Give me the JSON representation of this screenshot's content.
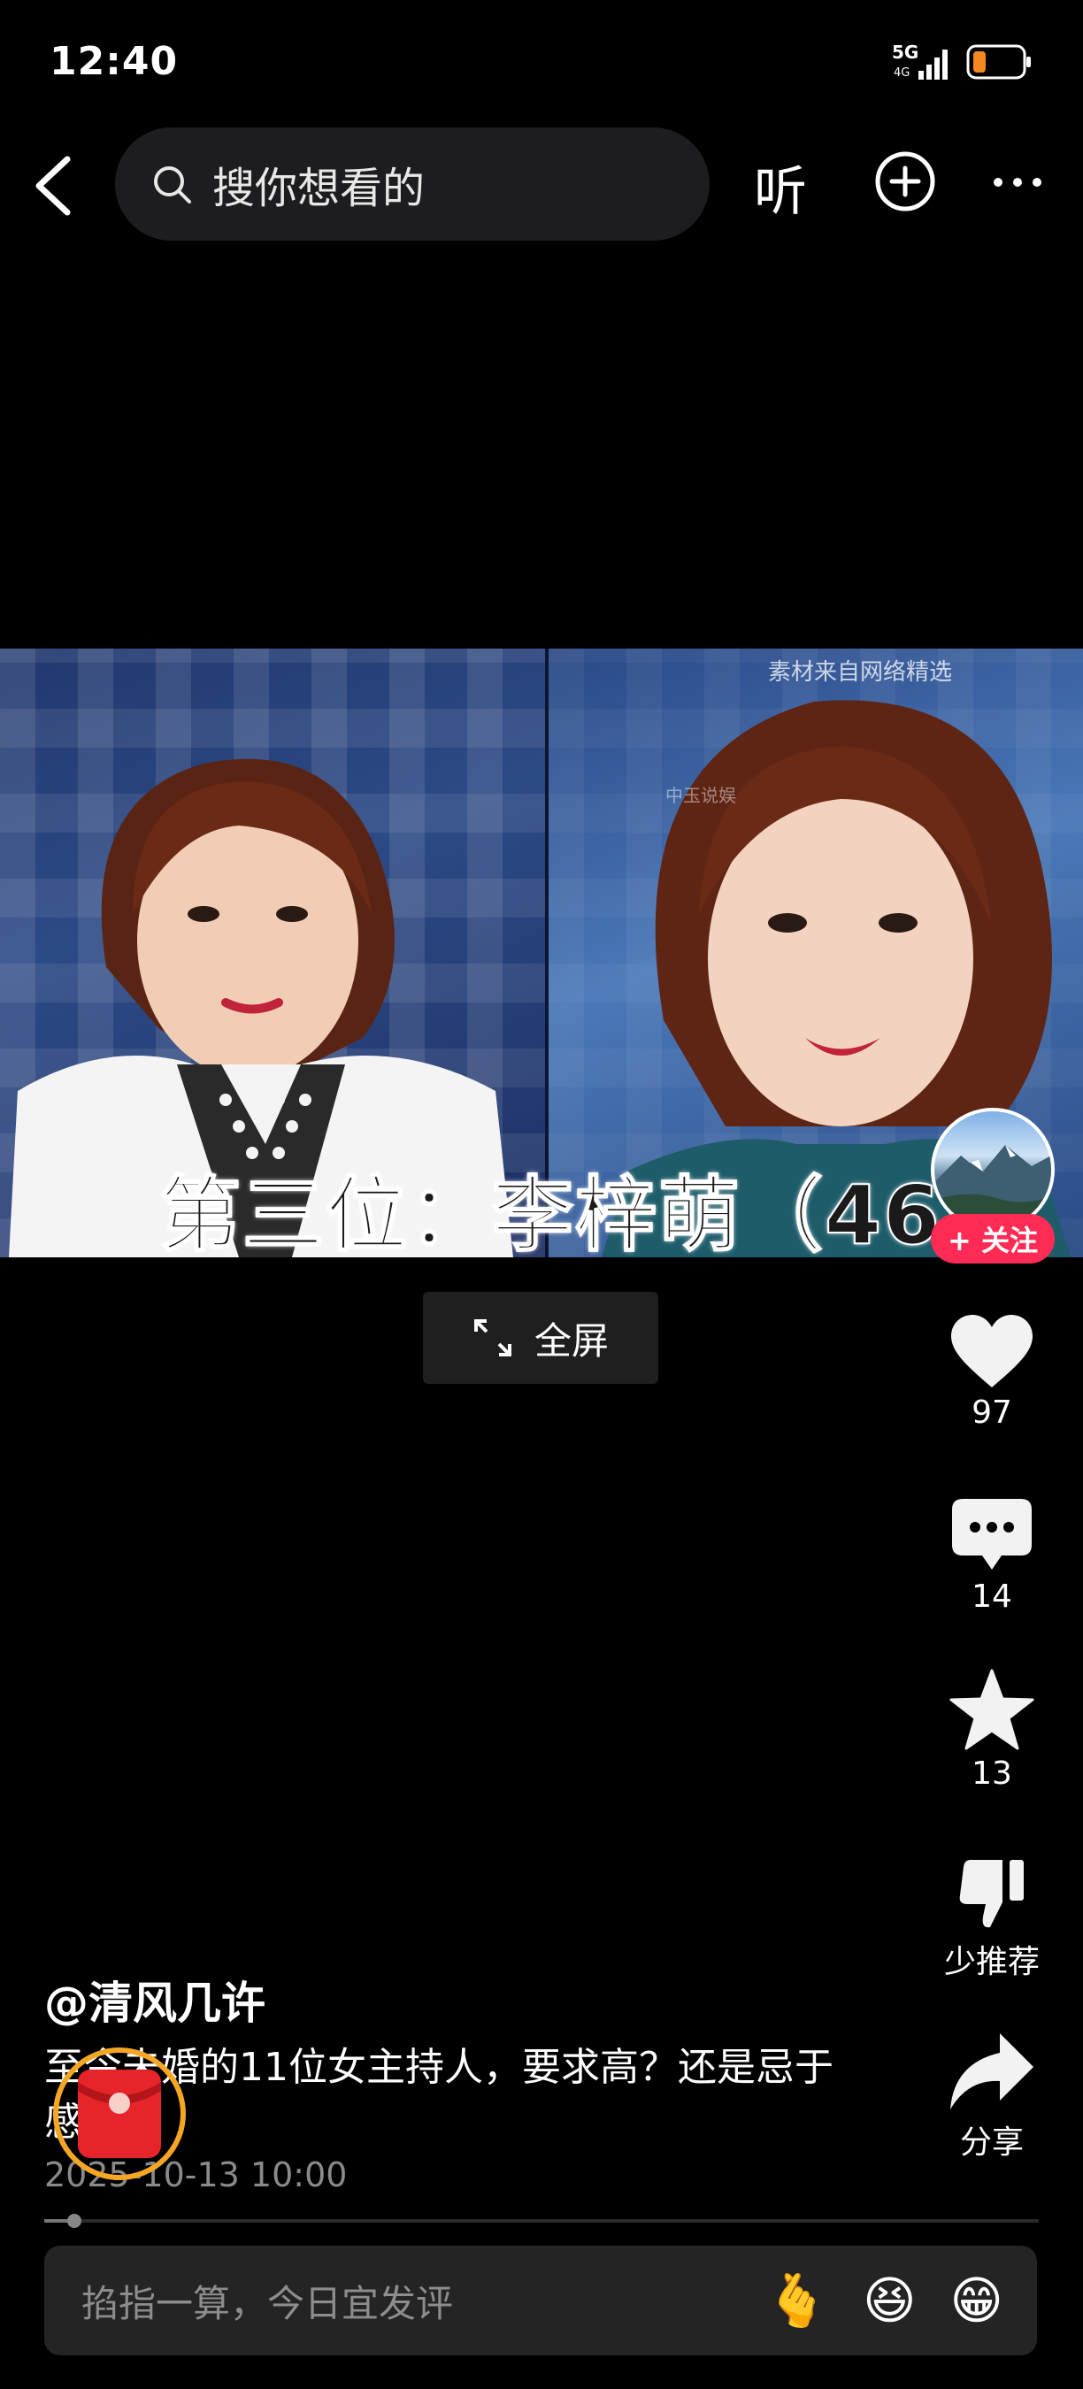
{
  "status_bar": {
    "time": "12:40",
    "network": "5G",
    "signal_sub": "4G"
  },
  "nav": {
    "search_placeholder": "搜你想看的",
    "listen_label": "听"
  },
  "video": {
    "caption": "第三位：李梓萌（46岁",
    "watermark": "素材来自网络精选",
    "watermark_secondary": "中玉说娱"
  },
  "follow": {
    "label": "+ 关注"
  },
  "fullscreen": {
    "label": "全屏"
  },
  "actions": {
    "likes": "97",
    "comments": "14",
    "favorites": "13",
    "dislike_label": "少推荐",
    "share_label": "分享"
  },
  "post": {
    "author": "@清风几许",
    "description": "至今未婚的11位女主持人，要求高？还是忌于感情？",
    "date": "2025-10-13 10:00"
  },
  "progress": {
    "played_fraction": 0.03
  },
  "comment_bar": {
    "placeholder": "掐指一算，今日宜发评",
    "emojis": [
      "🫰",
      "😆",
      "😁"
    ]
  },
  "colors": {
    "accent": "#fe2c55",
    "redpack_ring": "#f5a623"
  }
}
